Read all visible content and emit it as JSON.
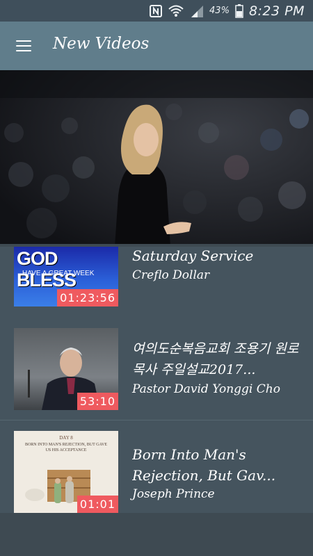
{
  "status_bar": {
    "battery_percent": "43%",
    "time": "8:23 PM",
    "icons": [
      "nfc-icon",
      "wifi-icon",
      "signal-icon",
      "battery-icon"
    ]
  },
  "app_bar": {
    "title": "New Videos",
    "menu_icon": "hamburger-menu-icon"
  },
  "hero": {
    "image": "speaker-on-stage-photo"
  },
  "videos": [
    {
      "thumb_text": "GOD BLESS",
      "thumb_subtext": "HAVE A GREAT WEEK",
      "title": "Saturday Service",
      "author": "Creflo Dollar",
      "duration": "01:23:56"
    },
    {
      "title": "여의도순복음교회 조용기 원로목사 주일설교2017...",
      "author": "Pastor David Yonggi Cho",
      "duration": "53:10"
    },
    {
      "thumb_text": "DAY 8",
      "thumb_subtext": "BORN INTO MAN'S REJECTION, BUT GAVE US HIS ACCEPTANCE",
      "title": "Born Into Man's Rejection, But Gav...",
      "author": "Joseph Prince",
      "duration": "01:01"
    }
  ],
  "colors": {
    "status_bar": "#3f4f5b",
    "app_bar": "#607d8b",
    "background": "#3e4a52",
    "card": "#45545e",
    "duration_badge": "#ef5a5f"
  }
}
